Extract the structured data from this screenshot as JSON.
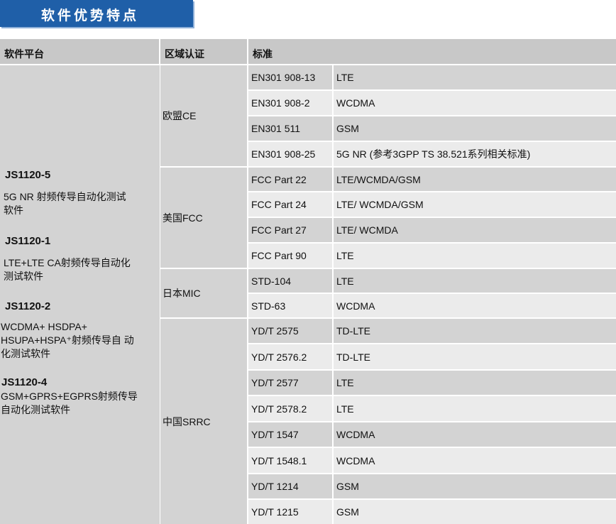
{
  "banner": {
    "title": "软件优势特点"
  },
  "headers": {
    "platform": "软件平台",
    "region": "区域认证",
    "standard": "标准"
  },
  "platforms": [
    {
      "name": "JS1120-5",
      "desc": [
        "5G NR 射频传导自动化测试",
        "软件"
      ]
    },
    {
      "name": "JS1120-1",
      "desc": [
        "LTE+LTE CA射频传导自动化",
        "测试软件"
      ]
    },
    {
      "name": "JS1120-2",
      "desc": [
        "WCDMA+ HSDPA+",
        "HSUPA+HSPA⁺射频传导自 动",
        "化测试软件"
      ]
    },
    {
      "name": "JS1120-4",
      "desc": [
        "GSM+GPRS+EGPRS射频传导",
        "自动化测试软件"
      ]
    }
  ],
  "regions": [
    {
      "name": "欧盟CE",
      "rows": [
        {
          "std": "EN301 908-13",
          "tech": "LTE"
        },
        {
          "std": "EN301 908-2",
          "tech": "WCDMA"
        },
        {
          "std": "EN301 511",
          "tech": "GSM"
        },
        {
          "std": "EN301 908-25",
          "tech": "5G NR (参考3GPP TS 38.521系列相关标准)"
        }
      ]
    },
    {
      "name": "美国FCC",
      "rows": [
        {
          "std": "FCC Part 22",
          "tech": "LTE/WCMDA/GSM"
        },
        {
          "std": "FCC Part 24",
          "tech": "LTE/ WCMDA/GSM"
        },
        {
          "std": "FCC Part 27",
          "tech": "LTE/ WCMDA"
        },
        {
          "std": "FCC Part 90",
          "tech": "LTE"
        }
      ]
    },
    {
      "name": "日本MIC",
      "rows": [
        {
          "std": "STD-104",
          "tech": "LTE"
        },
        {
          "std": "STD-63",
          "tech": "WCDMA"
        }
      ]
    },
    {
      "name": "中国SRRC",
      "rows": [
        {
          "std": "YD/T 2575",
          "tech": "TD-LTE"
        },
        {
          "std": "YD/T 2576.2",
          "tech": "TD-LTE"
        },
        {
          "std": "YD/T 2577",
          "tech": "LTE"
        },
        {
          "std": "YD/T 2578.2",
          "tech": "LTE"
        },
        {
          "std": "YD/T 1547",
          "tech": "WCDMA"
        },
        {
          "std": "YD/T 1548.1",
          "tech": "WCDMA"
        },
        {
          "std": "YD/T 1214",
          "tech": "GSM"
        },
        {
          "std": "YD/T 1215",
          "tech": "GSM"
        }
      ]
    }
  ]
}
